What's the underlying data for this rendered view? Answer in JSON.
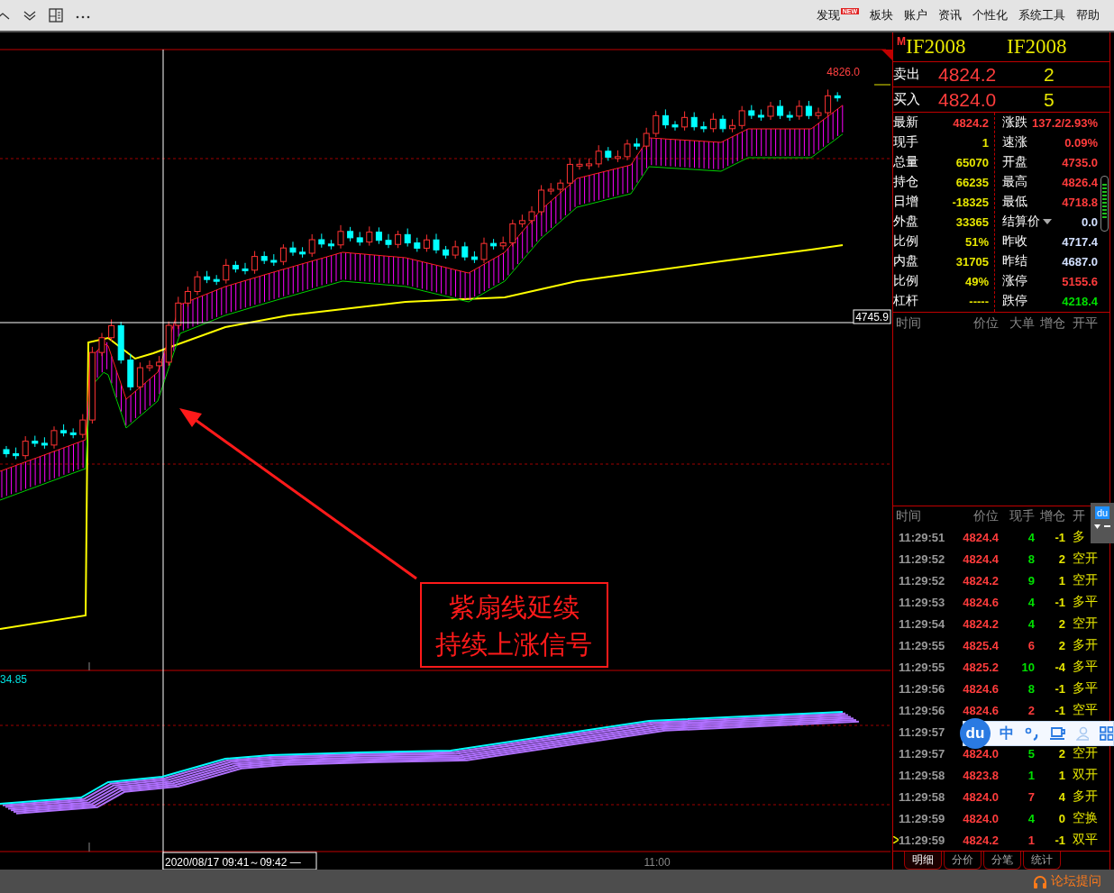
{
  "menu": [
    {
      "label": "发现",
      "badge": "NEW"
    },
    {
      "label": "板块"
    },
    {
      "label": "账户"
    },
    {
      "label": "资讯"
    },
    {
      "label": "个性化"
    },
    {
      "label": "系统工具"
    },
    {
      "label": "帮助"
    }
  ],
  "chart": {
    "high_label": "4826.0",
    "crosshair_price": "4745.9",
    "indicator_value": "34.85",
    "cursor_time": "2020/08/17 09:41～09:42 —",
    "time_tick": "11:00",
    "annotation": [
      "紫扇线延续",
      "持续上涨信号"
    ]
  },
  "quote": {
    "flag": "M",
    "code": "IF2008",
    "name": "IF2008",
    "book": [
      {
        "label": "卖出",
        "price": "4824.2",
        "qty": "2"
      },
      {
        "label": "买入",
        "price": "4824.0",
        "qty": "5"
      }
    ],
    "stats_left": [
      {
        "label": "最新",
        "value": "4824.2",
        "color": "#ff3c3c"
      },
      {
        "label": "现手",
        "value": "1",
        "color": "#e6e600"
      },
      {
        "label": "总量",
        "value": "65070",
        "color": "#e6e600"
      },
      {
        "label": "持仓",
        "value": "66235",
        "color": "#e6e600"
      },
      {
        "label": "日增",
        "value": "-18325",
        "color": "#e6e600"
      },
      {
        "label": "外盘",
        "value": "33365",
        "color": "#e6e600"
      },
      {
        "label": "比例",
        "value": "51%",
        "color": "#e6e600"
      },
      {
        "label": "内盘",
        "value": "31705",
        "color": "#e6e600"
      },
      {
        "label": "比例",
        "value": "49%",
        "color": "#e6e600"
      },
      {
        "label": "杠杆",
        "value": "-----",
        "color": "#e6e600"
      }
    ],
    "stats_right": [
      {
        "label": "涨跌",
        "value": "137.2/2.93%",
        "color": "#ff3c3c",
        "dropdown": false
      },
      {
        "label": "速涨",
        "value": "0.09%",
        "color": "#ff3c3c",
        "dropdown": false
      },
      {
        "label": "开盘",
        "value": "4735.0",
        "color": "#ff3c3c",
        "dropdown": false
      },
      {
        "label": "最高",
        "value": "4826.4",
        "color": "#ff3c3c",
        "dropdown": false
      },
      {
        "label": "最低",
        "value": "4718.8",
        "color": "#ff3c3c",
        "dropdown": false
      },
      {
        "label": "结算价",
        "value": "0.0",
        "color": "#d2e0ff",
        "dropdown": true
      },
      {
        "label": "昨收",
        "value": "4717.4",
        "color": "#d2e0ff",
        "dropdown": false
      },
      {
        "label": "昨结",
        "value": "4687.0",
        "color": "#d2e0ff",
        "dropdown": false
      },
      {
        "label": "涨停",
        "value": "5155.6",
        "color": "#ff3c3c",
        "dropdown": false
      },
      {
        "label": "跌停",
        "value": "4218.4",
        "color": "#00e000",
        "dropdown": false
      }
    ]
  },
  "big_orders": {
    "columns": [
      "时间",
      "价位",
      "大单",
      "增仓",
      "开平"
    ]
  },
  "trades": {
    "columns": [
      "时间",
      "价位",
      "现手",
      "增仓",
      "开"
    ],
    "rows": [
      {
        "time": "11:29:51",
        "price": "4824.4",
        "vol": "4",
        "color": "#00e000",
        "oi": "-1",
        "type": "多",
        "current": false
      },
      {
        "time": "11:29:52",
        "price": "4824.4",
        "vol": "8",
        "color": "#00e000",
        "oi": "2",
        "type": "空开",
        "current": false
      },
      {
        "time": "11:29:52",
        "price": "4824.2",
        "vol": "9",
        "color": "#00e000",
        "oi": "1",
        "type": "空开",
        "current": false
      },
      {
        "time": "11:29:53",
        "price": "4824.6",
        "vol": "4",
        "color": "#00e000",
        "oi": "-1",
        "type": "多平",
        "current": false
      },
      {
        "time": "11:29:54",
        "price": "4824.2",
        "vol": "4",
        "color": "#00e000",
        "oi": "2",
        "type": "空开",
        "current": false
      },
      {
        "time": "11:29:55",
        "price": "4825.4",
        "vol": "6",
        "color": "#ff3c3c",
        "oi": "2",
        "type": "多开",
        "current": false
      },
      {
        "time": "11:29:55",
        "price": "4825.2",
        "vol": "10",
        "color": "#00e000",
        "oi": "-4",
        "type": "多平",
        "current": false
      },
      {
        "time": "11:29:56",
        "price": "4824.6",
        "vol": "8",
        "color": "#00e000",
        "oi": "-1",
        "type": "多平",
        "current": false
      },
      {
        "time": "11:29:56",
        "price": "4824.6",
        "vol": "2",
        "color": "#ff3c3c",
        "oi": "-1",
        "type": "空平",
        "current": false
      },
      {
        "time": "11:29:57",
        "current": false
      },
      {
        "time": "11:29:57",
        "price": "4824.0",
        "vol": "5",
        "color": "#00e000",
        "oi": "2",
        "type": "空开",
        "current": false
      },
      {
        "time": "11:29:58",
        "price": "4823.8",
        "vol": "1",
        "color": "#00e000",
        "oi": "1",
        "type": "双开",
        "current": false
      },
      {
        "time": "11:29:58",
        "price": "4824.0",
        "vol": "7",
        "color": "#ff3c3c",
        "oi": "4",
        "type": "多开",
        "current": false
      },
      {
        "time": "11:29:59",
        "price": "4824.0",
        "vol": "4",
        "color": "#00e000",
        "oi": "0",
        "type": "空换",
        "current": false
      },
      {
        "time": "11:29:59",
        "price": "4824.2",
        "vol": "1",
        "color": "#ff3c3c",
        "oi": "-1",
        "type": "双平",
        "current": true
      }
    ]
  },
  "bottom_tabs": [
    {
      "label": "明细",
      "selected": true
    },
    {
      "label": "分价",
      "selected": false
    },
    {
      "label": "分笔",
      "selected": false
    },
    {
      "label": "统计",
      "selected": false
    }
  ],
  "ime_mini": {
    "logo": "du"
  },
  "ime": {
    "logo": "du",
    "mode": "中"
  },
  "status_bar": {
    "link": "论坛提问"
  }
}
